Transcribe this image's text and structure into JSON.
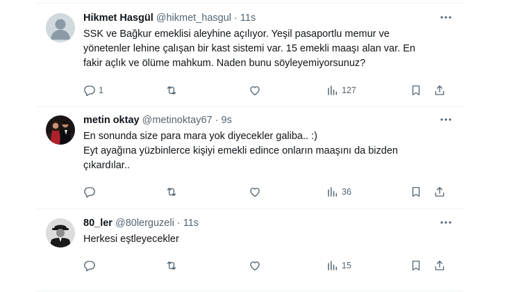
{
  "tweets": [
    {
      "name": "Hikmet Hasgül",
      "handle": "@hikmet_hasgul",
      "dot": "·",
      "time": "11s",
      "text": "SSK ve Bağkur emeklisi aleyhine açılıyor. Yeşil pasaportlu memur ve\nyönetenler lehine çalışan bir kast sistemi var. 15 emekli maaşı alan var. En\nfakir açlık ve ölüme mahkum. Naden bunu söyleyemiyorsunuz?",
      "replies": "1",
      "views": "127"
    },
    {
      "name": "metin oktay",
      "handle": "@metinoktay67",
      "dot": "·",
      "time": "9s",
      "text": "En sonunda size para mara yok diyecekler galiba.. :)\nEyt ayağına yüzbinlerce kişiyi emekli edince onların maaşını da bizden\nçıkardılar..",
      "replies": "",
      "views": "36"
    },
    {
      "name": "80_ler",
      "handle": "@80lerguzeli",
      "dot": "·",
      "time": "11s",
      "text": "Herkesi eştleyecekler",
      "replies": "",
      "views": "15"
    }
  ],
  "icons": {
    "reply": "reply-icon",
    "retweet": "retweet-icon",
    "like": "like-icon",
    "views": "views-icon",
    "bookmark": "bookmark-icon",
    "share": "share-icon",
    "more": "more-icon"
  },
  "colors": {
    "text": "#0f1419",
    "secondary": "#536471",
    "border": "#eff3f4"
  }
}
